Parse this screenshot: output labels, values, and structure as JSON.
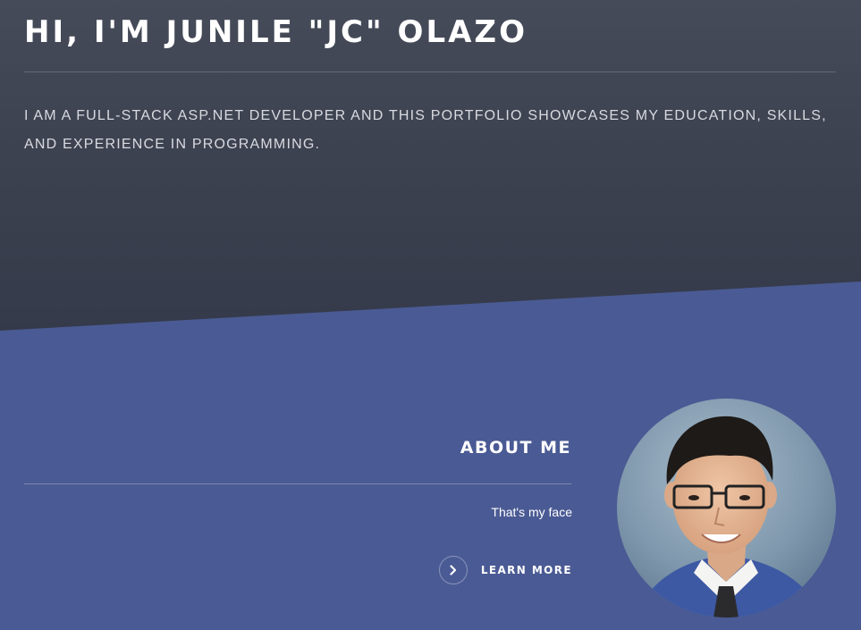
{
  "hero": {
    "title": "HI, I'M JUNILE \"JC\" OLAZO",
    "intro": "I AM A FULL-STACK ASP.NET DEVELOPER AND THIS PORTFOLIO SHOWCASES MY EDUCATION, SKILLS, AND EXPERIENCE IN PROGRAMMING."
  },
  "about": {
    "heading": "ABOUT ME",
    "caption": "That's my face",
    "link_label": "LEARN MORE",
    "link_icon": "chevron-right-icon"
  },
  "colors": {
    "hero_dark": "#3d4250",
    "section_blue": "#4a5a94",
    "text_white": "#ffffff"
  }
}
